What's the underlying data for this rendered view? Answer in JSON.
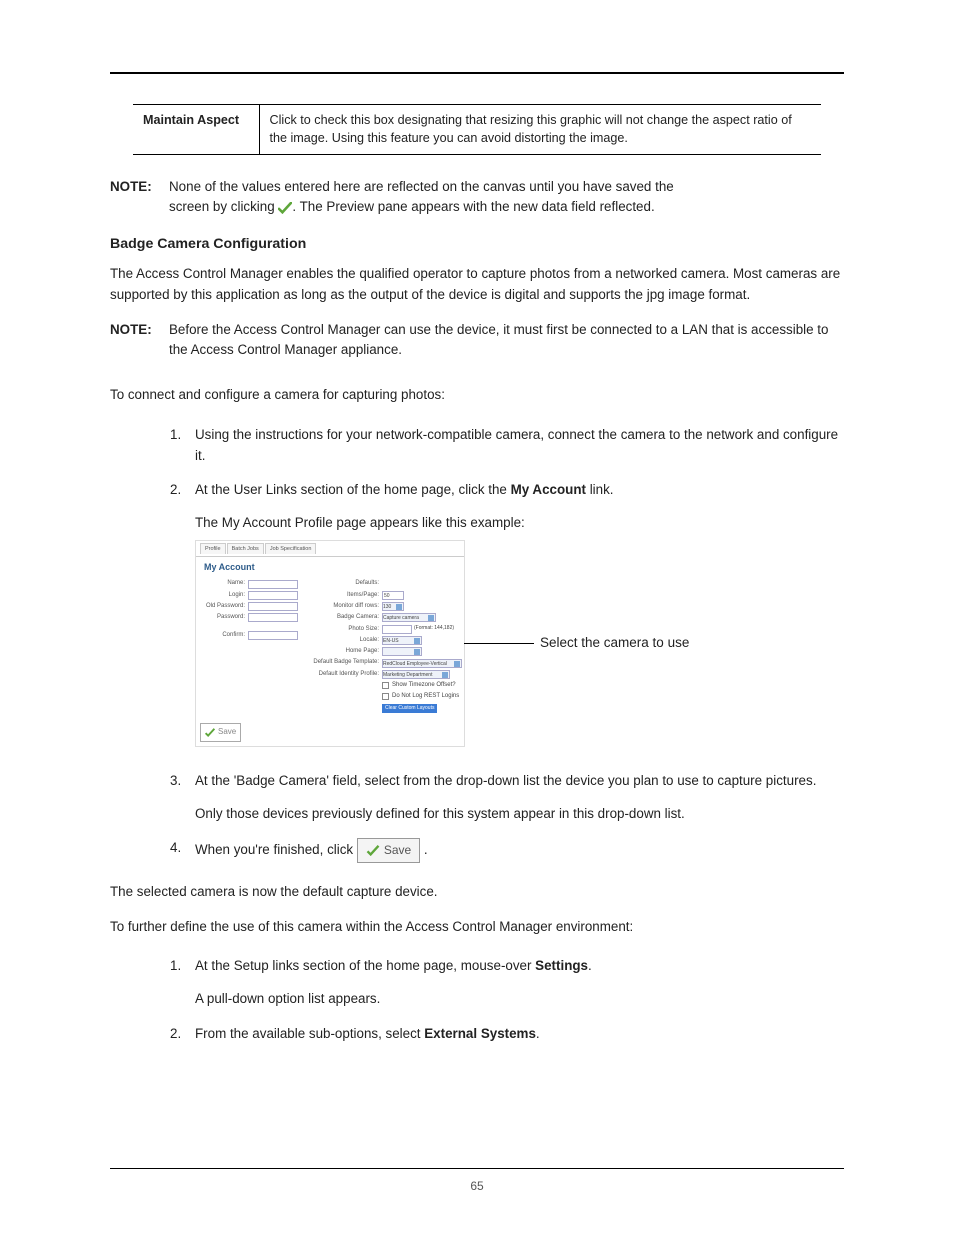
{
  "table": {
    "left": "Maintain Aspect",
    "right": "Click to check this box designating that resizing this graphic will not change the aspect ratio of the image. Using this feature you can avoid distorting the image."
  },
  "note1": {
    "label": "NOTE:",
    "line1": "None of the values entered here are reflected on the canvas until you have saved the",
    "line2a": "screen by clicking ",
    "line2b": ". The Preview pane appears with the new data field reflected."
  },
  "section_heading": "Badge Camera Configuration",
  "intro": "The Access Control Manager enables the qualified operator to capture photos from a networked camera. Most cameras are supported by this application as long as the output of the device is digital and supports the jpg image format.",
  "note2": {
    "label": "NOTE:",
    "text": "Before the Access Control Manager can use the device, it must first be connected to a LAN that is accessible to the Access Control Manager appliance."
  },
  "lead_in": "To connect and configure a camera for capturing photos:",
  "steps": {
    "s1": "Using the instructions for your network-compatible camera, connect the camera to the network and configure it.",
    "s2a": "At the User Links section of the home page, click the ",
    "s2_bold": "My Account",
    "s2b": " link.",
    "s2_sub": "The My Account Profile page appears like this example:",
    "s3": "At the 'Badge Camera' field, select from the drop-down list the device you plan to use to capture pictures.",
    "s3_sub": "Only those devices previously defined for this system appear in this drop-down list.",
    "s4a": "When you're finished, click  ",
    "s4b": " ."
  },
  "shot": {
    "tabs": {
      "t1": "Profile",
      "t2": "Batch Jobs",
      "t3": "Job Specification"
    },
    "title": "My Account",
    "left": {
      "name": "Name:",
      "login": "Login:",
      "oldpw": "Old Password:",
      "pw": "Password:",
      "confirm": "Confirm:"
    },
    "right": {
      "defaults": "Defaults:",
      "items_page": "Items/Page:",
      "items_page_v": "50",
      "diff_rows": "Monitor diff rows:",
      "diff_rows_v": "130",
      "badge_cam": "Badge Camera:",
      "badge_cam_v": "Capture camera",
      "photo_size": "Photo Size:",
      "photo_size_hint": "(Format: 144,182)",
      "locale": "Locale:",
      "locale_v": "EN-US",
      "home": "Home Page:",
      "def_badge": "Default Badge Template:",
      "def_badge_v": "RedCloud Employee-Vertical",
      "def_ident": "Default Identity Profile:",
      "def_ident_v": "Marketing Department",
      "show_tz": "Show Timezone Offset?",
      "no_log": "Do Not Log REST Logins",
      "clear": "Clear Custom Layouts"
    },
    "save": "Save"
  },
  "callout": "Select the camera to use",
  "after1": "The selected camera is now the default capture device.",
  "after2": "To further define the use of this camera within the Access Control Manager environment:",
  "steps2": {
    "s1a": "At the Setup links section of the home page, mouse-over ",
    "s1_bold": "Settings",
    "s1b": ".",
    "s1_sub": "A pull-down option list appears.",
    "s2a": "From the available sub-options, select ",
    "s2_bold": "External Systems",
    "s2b": "."
  },
  "pagenum": "65",
  "save_label": "Save"
}
